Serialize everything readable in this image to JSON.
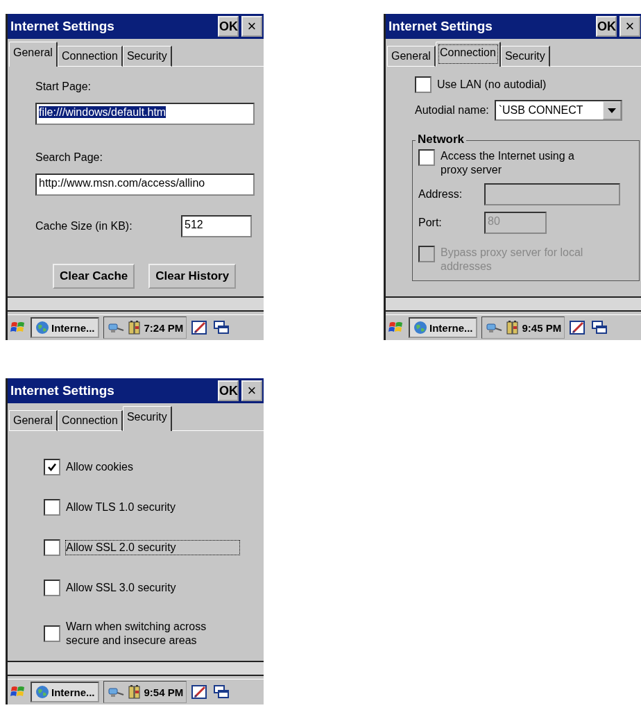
{
  "screens": [
    {
      "kind": "general",
      "title": "Internet Settings",
      "ok_label": "OK",
      "close_label": "×",
      "tabs": [
        {
          "label": "General",
          "selected": true,
          "focused": false
        },
        {
          "label": "Connection",
          "selected": false,
          "focused": false
        },
        {
          "label": "Security",
          "selected": false,
          "focused": false
        }
      ],
      "fields": [
        {
          "label": "Start Page:",
          "value": "file:///windows/default.htm",
          "highlighted": true
        },
        {
          "label": "Search Page:",
          "value": "http://www.msn.com/access/allino",
          "highlighted": false
        }
      ],
      "cache": {
        "label": "Cache Size (in KB):",
        "value": "512"
      },
      "buttons": [
        "Clear Cache",
        "Clear History"
      ],
      "taskbar": {
        "app_label": "Interne...",
        "time": "7:24 PM"
      }
    },
    {
      "kind": "connection",
      "title": "Internet Settings",
      "ok_label": "OK",
      "close_label": "×",
      "tabs": [
        {
          "label": "General",
          "selected": false,
          "focused": false
        },
        {
          "label": "Connection",
          "selected": true,
          "focused": true
        },
        {
          "label": "Security",
          "selected": false,
          "focused": false
        }
      ],
      "use_lan": {
        "label": "Use LAN (no autodial)",
        "checked": false
      },
      "autodial": {
        "label": "Autodial name:",
        "value": "`USB CONNECT"
      },
      "network": {
        "title": "Network",
        "proxy": {
          "label": "Access the Internet using a proxy server",
          "checked": false
        },
        "address": {
          "label": "Address:",
          "disabled": true
        },
        "port": {
          "label": "Port:",
          "value": "80",
          "disabled": true
        },
        "bypass": {
          "label": "Bypass proxy server for local addresses",
          "checked": false,
          "disabled": true
        }
      },
      "taskbar": {
        "app_label": "Interne...",
        "time": "9:45 PM"
      }
    },
    {
      "kind": "security",
      "title": "Internet Settings",
      "ok_label": "OK",
      "close_label": "×",
      "tabs": [
        {
          "label": "General",
          "selected": false,
          "focused": false
        },
        {
          "label": "Connection",
          "selected": false,
          "focused": false
        },
        {
          "label": "Security",
          "selected": true,
          "focused": false
        }
      ],
      "options": [
        {
          "label": "Allow cookies",
          "checked": true,
          "focused": false
        },
        {
          "label": "Allow TLS 1.0 security",
          "checked": false,
          "focused": false
        },
        {
          "label": "Allow SSL 2.0 security",
          "checked": false,
          "focused": true
        },
        {
          "label": "Allow SSL 3.0 security",
          "checked": false,
          "focused": false
        },
        {
          "label": "Warn when switching across secure and insecure areas",
          "checked": false,
          "focused": false
        }
      ],
      "taskbar": {
        "app_label": "Interne...",
        "time": "9:54 PM"
      }
    }
  ]
}
